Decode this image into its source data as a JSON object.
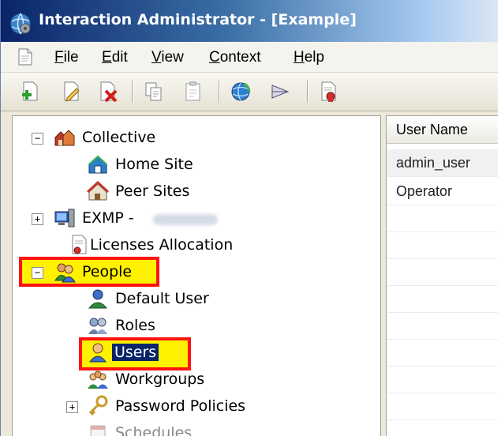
{
  "window": {
    "title": "Interaction Administrator - [Example]"
  },
  "menu": {
    "items": [
      {
        "label": "File",
        "accel": "F",
        "rest": "ile"
      },
      {
        "label": "Edit",
        "accel": "E",
        "rest": "dit"
      },
      {
        "label": "View",
        "accel": "V",
        "rest": "iew"
      },
      {
        "label": "Context",
        "accel": "C",
        "rest": "ontext"
      },
      {
        "label": "Help",
        "accel": "H",
        "rest": "elp"
      }
    ]
  },
  "toolbar": {
    "buttons": [
      "new-icon",
      "edit-icon",
      "delete-icon",
      "copy-icon",
      "paste-icon",
      "refresh-globe-icon",
      "tune-icon",
      "properties-icon"
    ]
  },
  "tree": {
    "collective": {
      "label": "Collective",
      "expander": "−"
    },
    "home_site": {
      "label": "Home Site"
    },
    "peer_sites": {
      "label": "Peer Sites"
    },
    "server": {
      "label": "EXMP -",
      "expander": "+"
    },
    "licenses": {
      "label": "Licenses Allocation"
    },
    "people": {
      "label": "People",
      "expander": "−"
    },
    "default_user": {
      "label": "Default User"
    },
    "roles": {
      "label": "Roles"
    },
    "users": {
      "label": "Users"
    },
    "workgroups": {
      "label": "Workgroups"
    },
    "password_policies": {
      "label": "Password Policies",
      "expander": "+"
    },
    "schedules": {
      "label": "Schedules"
    }
  },
  "list": {
    "column_header": "User Name",
    "rows": [
      "admin_user",
      "Operator"
    ]
  },
  "colors": {
    "highlight_border": "#ff1212",
    "highlight_fill": "#fff200",
    "selection": "#0a246a"
  }
}
